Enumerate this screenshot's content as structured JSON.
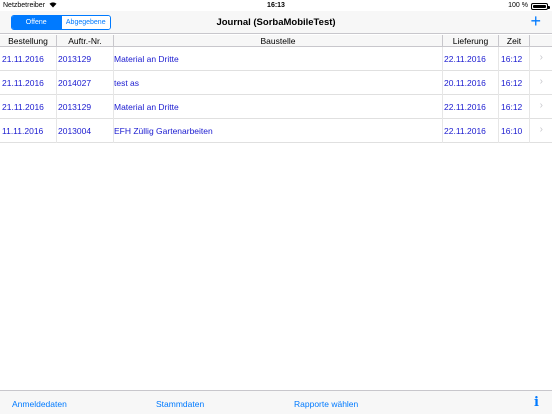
{
  "status": {
    "carrier": "Netzbetreiber",
    "time": "16:13",
    "battery": "100 %"
  },
  "nav": {
    "segments": [
      "Offene",
      "Abgegebene"
    ],
    "active_segment": "Offene",
    "title": "Journal (SorbaMobileTest)",
    "add": "+"
  },
  "table": {
    "headers": {
      "bestellung": "Bestellung",
      "auftrag": "Auftr.-Nr.",
      "baustelle": "Baustelle",
      "lieferung": "Lieferung",
      "zeit": "Zeit"
    },
    "rows": [
      {
        "bestellung": "21.11.2016",
        "auftrag": "2013129",
        "baustelle": "Material an Dritte",
        "lieferung": "22.11.2016",
        "zeit": "16:12"
      },
      {
        "bestellung": "21.11.2016",
        "auftrag": "2014027",
        "baustelle": "test as",
        "lieferung": "20.11.2016",
        "zeit": "16:12"
      },
      {
        "bestellung": "21.11.2016",
        "auftrag": "2013129",
        "baustelle": "Material an Dritte",
        "lieferung": "22.11.2016",
        "zeit": "16:12"
      },
      {
        "bestellung": "11.11.2016",
        "auftrag": "2013004",
        "baustelle": "EFH Züllig Gartenarbeiten",
        "lieferung": "22.11.2016",
        "zeit": "16:10"
      }
    ]
  },
  "tabbar": {
    "anmeldedaten": "Anmeldedaten",
    "stammdaten": "Stammdaten",
    "rapporte": "Rapporte wählen",
    "info": "i"
  },
  "colors": {
    "accent": "#007aff",
    "row_text": "#1a1ad0",
    "bar_background": "#f7f7f7"
  }
}
